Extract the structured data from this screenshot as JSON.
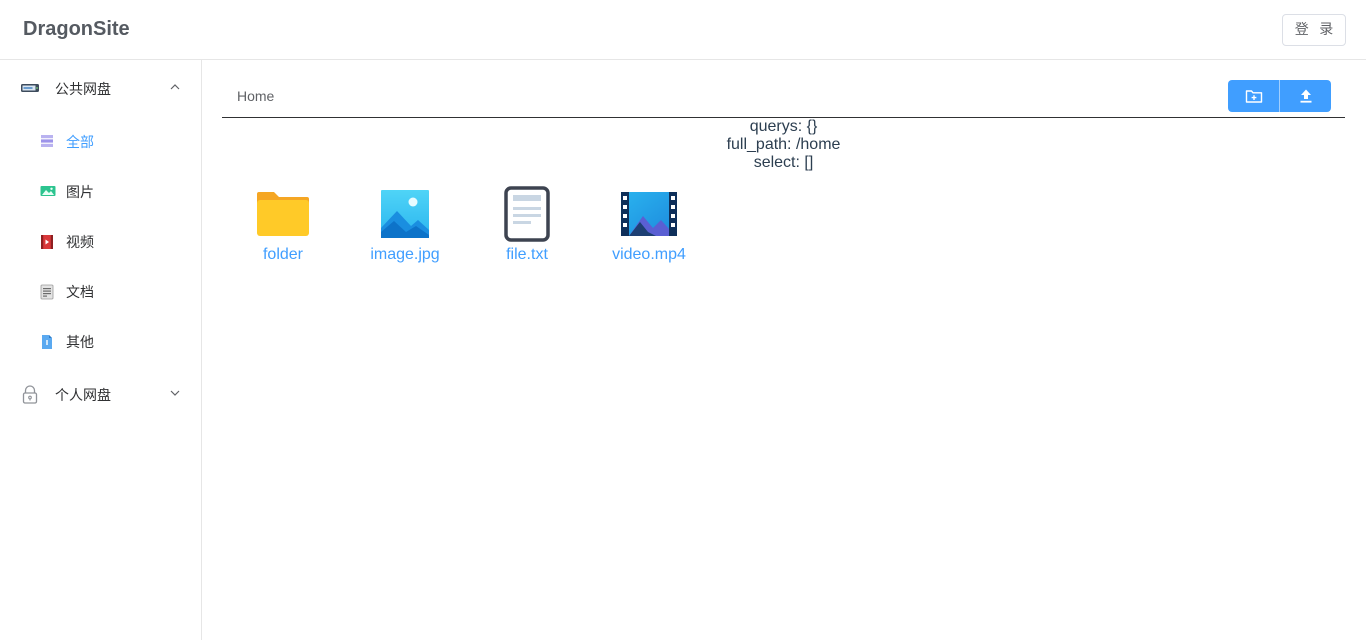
{
  "app": {
    "title": "DragonSite",
    "login_label": "登 录"
  },
  "sidebar": {
    "public_group": {
      "label": "公共网盘",
      "icon": "drive-icon",
      "expanded": true
    },
    "items": [
      {
        "label": "全部",
        "icon": "list-icon",
        "active": true
      },
      {
        "label": "图片",
        "icon": "image-icon"
      },
      {
        "label": "视频",
        "icon": "video-icon"
      },
      {
        "label": "文档",
        "icon": "document-icon"
      },
      {
        "label": "其他",
        "icon": "other-file-icon"
      }
    ],
    "personal_group": {
      "label": "个人网盘",
      "icon": "lock-icon",
      "expanded": false
    }
  },
  "breadcrumb": {
    "home": "Home"
  },
  "toolbar": {
    "new_folder_icon": "folder-plus-icon",
    "upload_icon": "upload-icon"
  },
  "debug": {
    "querys": "querys: {}",
    "full_path": "full_path: /home",
    "select": "select: []"
  },
  "files": [
    {
      "name": "folder",
      "type": "folder"
    },
    {
      "name": "image.jpg",
      "type": "image"
    },
    {
      "name": "file.txt",
      "type": "text"
    },
    {
      "name": "video.mp4",
      "type": "video"
    }
  ],
  "colors": {
    "accent": "#409eff",
    "text": "#303133",
    "border": "#e6e6e6"
  }
}
